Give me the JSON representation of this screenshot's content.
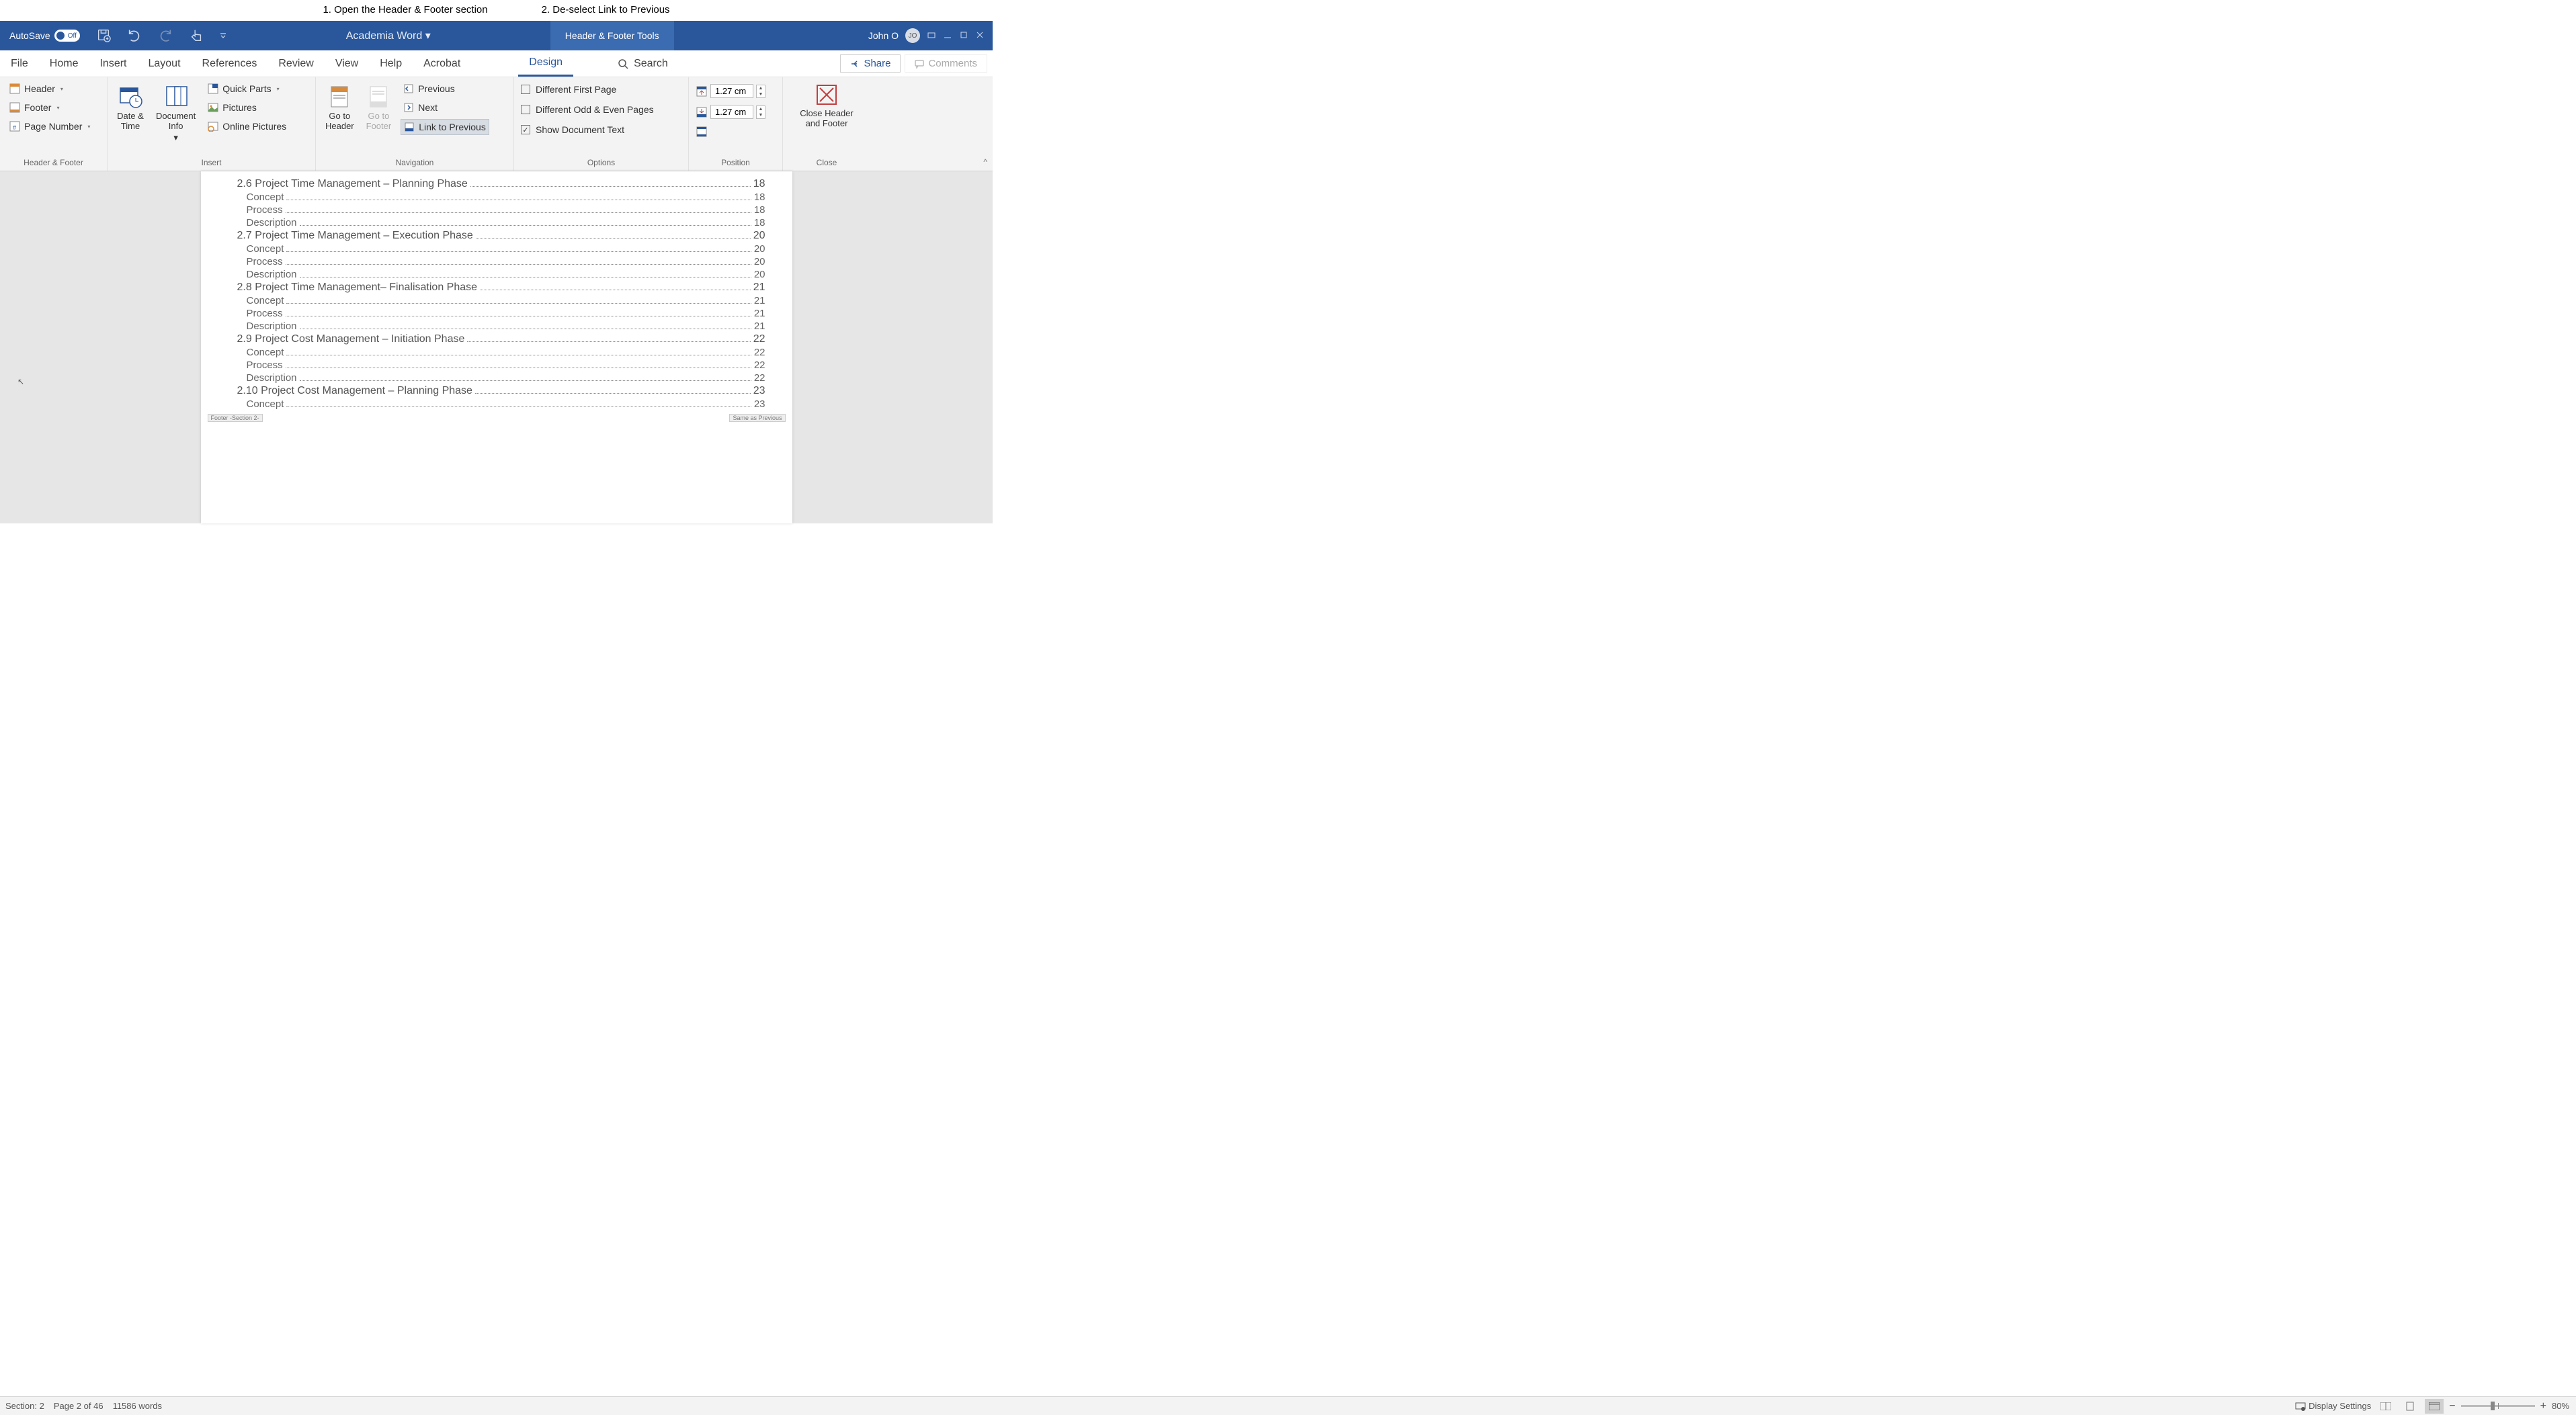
{
  "instructions": {
    "step1": "1. Open the Header & Footer section",
    "step2": "2. De-select Link to Previous"
  },
  "titlebar": {
    "autosave_label": "AutoSave",
    "autosave_state": "Off",
    "doc_title": "Academia Word  ▾",
    "context_tab": "Header & Footer Tools",
    "user_name": "John O",
    "user_initials": "JO"
  },
  "menu": {
    "tabs": [
      "File",
      "Home",
      "Insert",
      "Layout",
      "References",
      "Review",
      "View",
      "Help",
      "Acrobat",
      "Design"
    ],
    "active_index": 9,
    "search_label": "Search",
    "share_label": "Share",
    "comments_label": "Comments"
  },
  "ribbon": {
    "groups": {
      "hf": {
        "label": "Header & Footer",
        "header": "Header",
        "footer": "Footer",
        "page_number": "Page Number"
      },
      "insert": {
        "label": "Insert",
        "date_time": "Date &\nTime",
        "doc_info": "Document\nInfo",
        "quick_parts": "Quick Parts",
        "pictures": "Pictures",
        "online_pictures": "Online Pictures"
      },
      "navigation": {
        "label": "Navigation",
        "goto_header": "Go to\nHeader",
        "goto_footer": "Go to\nFooter",
        "previous": "Previous",
        "next": "Next",
        "link_previous": "Link to Previous"
      },
      "options": {
        "label": "Options",
        "diff_first": "Different First Page",
        "diff_odd_even": "Different Odd & Even Pages",
        "show_doc_text": "Show Document Text"
      },
      "position": {
        "label": "Position",
        "header_from_top": "1.27 cm",
        "footer_from_bottom": "1.27 cm"
      },
      "close": {
        "label": "Close",
        "close_hf": "Close Header\nand Footer"
      }
    }
  },
  "document": {
    "toc": [
      {
        "level": "h",
        "text": "2.6 Project Time Management – Planning Phase",
        "page": "18"
      },
      {
        "level": "sub",
        "text": "Concept",
        "page": "18"
      },
      {
        "level": "sub",
        "text": "Process",
        "page": "18"
      },
      {
        "level": "sub",
        "text": "Description",
        "page": "18"
      },
      {
        "level": "h",
        "text": "2.7 Project Time Management – Execution Phase",
        "page": "20"
      },
      {
        "level": "sub",
        "text": "Concept",
        "page": "20"
      },
      {
        "level": "sub",
        "text": "Process",
        "page": "20"
      },
      {
        "level": "sub",
        "text": "Description",
        "page": "20"
      },
      {
        "level": "h",
        "text": "2.8 Project Time Management– Finalisation Phase",
        "page": "21"
      },
      {
        "level": "sub",
        "text": "Concept",
        "page": "21"
      },
      {
        "level": "sub",
        "text": "Process",
        "page": "21"
      },
      {
        "level": "sub",
        "text": "Description",
        "page": "21"
      },
      {
        "level": "h",
        "text": "2.9 Project Cost Management – Initiation Phase",
        "page": "22"
      },
      {
        "level": "sub",
        "text": "Concept",
        "page": "22"
      },
      {
        "level": "sub",
        "text": "Process",
        "page": "22"
      },
      {
        "level": "sub",
        "text": "Description",
        "page": "22"
      },
      {
        "level": "h",
        "text": "2.10 Project Cost Management – Planning Phase",
        "page": "23"
      },
      {
        "level": "sub",
        "text": "Concept",
        "page": "23"
      }
    ],
    "footer_tag_left": "Footer -Section 2-",
    "footer_tag_right": "Same as Previous"
  },
  "statusbar": {
    "section": "Section: 2",
    "page": "Page 2 of 46",
    "words": "11586 words",
    "display_settings": "Display Settings",
    "zoom": "80%"
  }
}
